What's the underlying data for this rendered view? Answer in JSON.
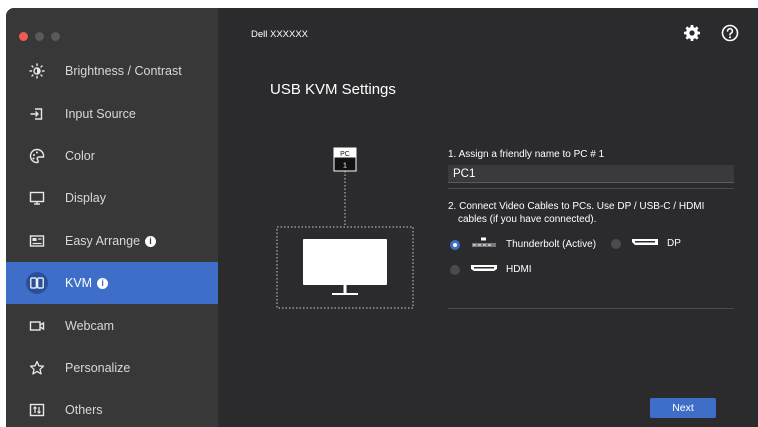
{
  "window": {
    "model_name": "Dell XXXXXX",
    "traffic_light_colors": {
      "close": "#ee5b57",
      "minimize": "#5a5a5c",
      "maximize": "#5a5a5c"
    }
  },
  "colors": {
    "accent": "#3f6ec9",
    "sidebar_bg": "#383839",
    "main_bg": "#2b2b2d"
  },
  "sidebar": {
    "items": [
      {
        "label": "Brightness / Contrast",
        "icon": "sun-icon"
      },
      {
        "label": "Input Source",
        "icon": "input-source-icon"
      },
      {
        "label": "Color",
        "icon": "palette-icon"
      },
      {
        "label": "Display",
        "icon": "monitor-icon"
      },
      {
        "label": "Easy Arrange",
        "icon": "layout-icon",
        "badge": "i"
      },
      {
        "label": "KVM",
        "icon": "kvm-icon",
        "badge": "i",
        "active": true
      },
      {
        "label": "Webcam",
        "icon": "webcam-icon"
      },
      {
        "label": "Personalize",
        "icon": "star-icon"
      },
      {
        "label": "Others",
        "icon": "others-icon"
      }
    ]
  },
  "header": {
    "settings_icon": "gear-icon",
    "help_icon": "help-icon"
  },
  "main": {
    "title": "USB KVM Settings",
    "diagram": {
      "pc_label": "PC",
      "pc_number": "1"
    },
    "step1_label": "1. Assign a friendly name to PC # 1",
    "pc_name_value": "PC1",
    "step2_line1": "2. Connect Video Cables to PCs. Use DP / USB-C / HDMI",
    "step2_line2": "cables (if you have connected).",
    "options": [
      {
        "label": "Thunderbolt (Active)",
        "checked": true,
        "icon": "thunderbolt-port-icon"
      },
      {
        "label": "DP",
        "checked": false,
        "icon": "dp-port-icon"
      },
      {
        "label": "HDMI",
        "checked": false,
        "icon": "hdmi-port-icon"
      }
    ],
    "next_label": "Next"
  }
}
